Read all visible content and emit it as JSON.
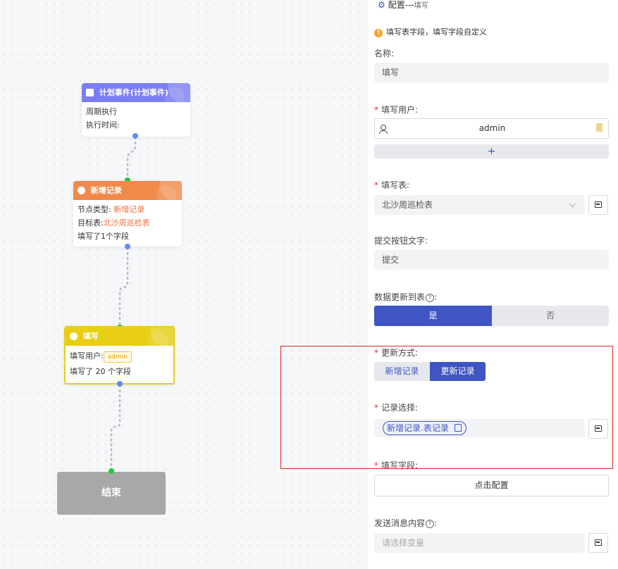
{
  "canvas": {
    "node_plan": {
      "title": "计划事件(计划事件)",
      "line1": "周期执行",
      "line2": "执行时间:"
    },
    "node_add": {
      "title": "新增记录",
      "type_label": "节点类型:",
      "type_value": "新增记录",
      "table_label": "目标表:",
      "table_value": "北沙周巡检表",
      "fields_text": "填写了1个字段"
    },
    "node_fill": {
      "title": "填写",
      "user_label": "填写用户:",
      "user_badge": "admin",
      "fields_text": "填写了 20 个字段"
    },
    "node_end": {
      "title": "结束"
    }
  },
  "panel": {
    "header_title": "配置---",
    "header_sub": "填写",
    "tip": "填写表字段，填写字段自定义",
    "name_label": "名称:",
    "name_value": "填写",
    "user_label": "填写用户:",
    "user_value": "admin",
    "add_symbol": "+",
    "table_label": "填写表:",
    "table_value": "北沙周巡检表",
    "submit_label": "提交按钮文字:",
    "submit_value": "提交",
    "update_table_label": "数据更新到表",
    "yes": "是",
    "no": "否",
    "update_mode_label": "更新方式:",
    "mode_add": "新增记录",
    "mode_update": "更新记录",
    "record_label": "记录选择:",
    "record_tag": "新增记录.表记录",
    "fill_fields_label": "填写字段:",
    "config_button": "点击配置",
    "message_label": "发送消息内容",
    "message_placeholder": "请选择变量"
  },
  "colors": {
    "plan_head": "#7b7ef2",
    "add_head": "#f08a4b",
    "fill_head": "#e8cf14",
    "accent": "#3f55c4",
    "highlight_box": "#e02424"
  }
}
